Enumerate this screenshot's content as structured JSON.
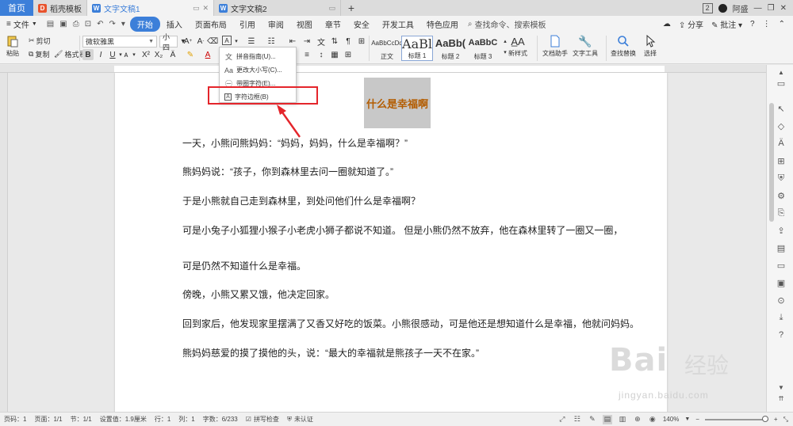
{
  "tabs": {
    "home": "首页",
    "items": [
      {
        "label": "稻壳模板",
        "icon": "D"
      },
      {
        "label": "文字文稿1",
        "icon": "W"
      },
      {
        "label": "文字文稿2",
        "icon": "W"
      }
    ],
    "window_num": "2",
    "user": "阿盛"
  },
  "menubar": {
    "file": "文件",
    "items": [
      "开始",
      "插入",
      "页面布局",
      "引用",
      "审阅",
      "视图",
      "章节",
      "安全",
      "开发工具",
      "特色应用"
    ],
    "search_placeholder": "查找命令、搜索模板",
    "share": "分享",
    "comment": "批注",
    "help": "?"
  },
  "ribbon": {
    "paste": "粘贴",
    "cut": "剪切",
    "copy": "复制",
    "format_painter": "格式刷",
    "font_name": "微软雅黑",
    "font_size": "小四",
    "styles": [
      {
        "preview": "AaBbCcDd",
        "label": "正文"
      },
      {
        "preview": "AaBl",
        "label": "标题 1"
      },
      {
        "preview": "AaBb(",
        "label": "标题 2"
      },
      {
        "preview": "AaBbC",
        "label": "标题 3"
      }
    ],
    "new_style": "新样式",
    "doc_helper": "文档助手",
    "text_tools": "文字工具",
    "find_replace": "查找替换",
    "select": "选择"
  },
  "dropdown": {
    "items": [
      "拼音指南(U)...",
      "更改大小写(C)...",
      "带圈字符(E)...",
      "字符边框(B)"
    ]
  },
  "document": {
    "title": "什么是幸福啊",
    "paragraphs": [
      "一天，小熊问熊妈妈：“妈妈，妈妈，什么是幸福啊？”",
      "熊妈妈说：“孩子，你到森林里去问一圈就知道了。”",
      "于是小熊就自己走到森林里，到处问他们什么是幸福啊？",
      "可是小兔子小狐狸小猴子小老虎小狮子都说不知道。  但是小熊仍然不放弃，他在森林里转了一圈又一圈，",
      "可是仍然不知道什么是幸福。",
      "傍晚，小熊又累又饿，他决定回家。",
      "回到家后，他发现家里摆满了又香又好吃的饭菜。小熊很感动，可是他还是想知道什么是幸福，他就问妈妈。",
      "熊妈妈慈爱的摸了摸他的头，说：“最大的幸福就是熊孩子一天不在家。”"
    ]
  },
  "statusbar": {
    "page_num": "页码：1",
    "pages": "页面：1/1",
    "section": "节：1/1",
    "setting": "设置值：1.9厘米",
    "row": "行：1",
    "col": "列：1",
    "words": "字数：6/233",
    "spell": "拼写检查",
    "auth": "未认证",
    "zoom": "140%"
  },
  "watermark": {
    "logo": "Bai",
    "suffix": "经验",
    "url": "jingyan.baidu.com"
  }
}
